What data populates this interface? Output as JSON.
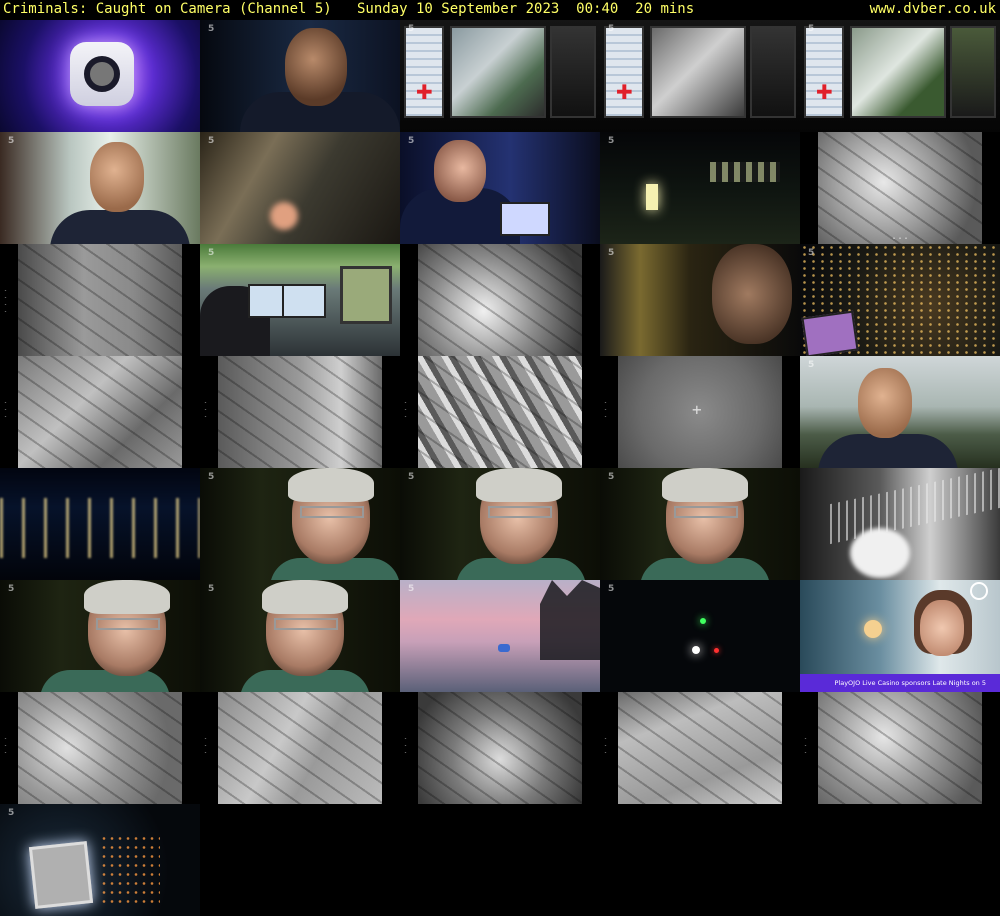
{
  "header": {
    "title": "Criminals: Caught on Camera (Channel 5)   Sunday 10 September 2023  00:40  20 mins",
    "site": "www.dvber.co.uk"
  },
  "colors": {
    "background": "#000000",
    "header_text": "#ffff66",
    "ad_banner": "#5a2ad8"
  },
  "channel_watermark": "5",
  "ad": {
    "banner_text": "PlayOJO Live Casino sponsors Late Nights on 5"
  }
}
